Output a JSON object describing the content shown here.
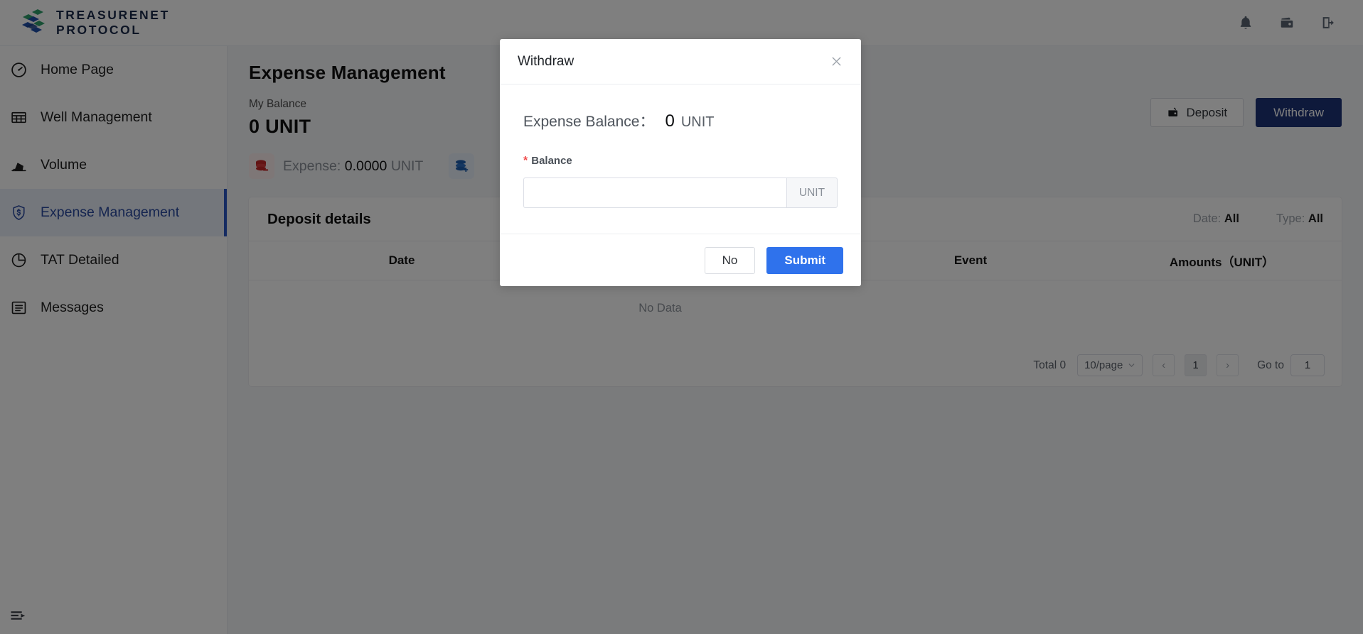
{
  "brand": {
    "line1": "TREASURENET",
    "line2": "PROTOCOL",
    "logo_colors": {
      "green": "#2e9e6b",
      "blue": "#1f4fa8"
    }
  },
  "topbar": {
    "icons": [
      {
        "name": "notification-bell-icon",
        "label": "Notifications"
      },
      {
        "name": "wallet-icon",
        "label": "Wallet"
      },
      {
        "name": "logout-icon",
        "label": "Logout"
      }
    ]
  },
  "sidebar": {
    "items": [
      {
        "label": "Home Page",
        "icon": "dashboard-gauge-icon",
        "active": false
      },
      {
        "label": "Well Management",
        "icon": "table-grid-icon",
        "active": false
      },
      {
        "label": "Volume",
        "icon": "oil-pump-icon",
        "active": false
      },
      {
        "label": "Expense Management",
        "icon": "shield-dollar-icon",
        "active": true
      },
      {
        "label": "TAT Detailed",
        "icon": "pie-chart-icon",
        "active": false
      },
      {
        "label": "Messages",
        "icon": "list-box-icon",
        "active": false
      }
    ],
    "collapse_icon": "sidebar-collapse-icon",
    "active_accent": "#2b57c4",
    "active_bg": "#e8eef9"
  },
  "main": {
    "page_title": "Expense Management",
    "balance": {
      "label": "My Balance",
      "value": "0 UNIT"
    },
    "stats": [
      {
        "icon": "red-coins-icon",
        "label": "Expense:",
        "value": "0.0000",
        "unit": "UNIT",
        "color": "#c62828"
      },
      {
        "icon": "blue-coins-plus-icon",
        "label": "",
        "value": "",
        "unit": "",
        "color": "#1f5fae"
      }
    ],
    "actions": {
      "deposit_label": "Deposit",
      "deposit_icon": "deposit-wallet-icon",
      "withdraw_label": "Withdraw",
      "withdraw_color": "#1c3277"
    },
    "table": {
      "title": "Deposit details",
      "filters": [
        {
          "label": "Date:",
          "value": "All"
        },
        {
          "label": "Type:",
          "value": "All"
        }
      ],
      "columns": [
        "Date",
        "",
        "Event",
        "Amounts（UNIT）"
      ],
      "rows": [],
      "empty_text": "No Data"
    },
    "pagination": {
      "total_text": "Total 0",
      "page_size": "10/page",
      "prev_label": "‹",
      "current_page": "1",
      "next_label": "›",
      "goto_label": "Go to",
      "goto_value": "1"
    }
  },
  "modal": {
    "title": "Withdraw",
    "close_icon": "close-icon",
    "expense_balance_label": "Expense Balance：",
    "expense_balance_value": "0",
    "expense_balance_unit": "UNIT",
    "field": {
      "required_marker": "*",
      "label": "Balance",
      "value": "",
      "placeholder": "",
      "addon": "UNIT"
    },
    "buttons": {
      "cancel_label": "No",
      "submit_label": "Submit",
      "submit_color": "#2f72ec"
    }
  }
}
